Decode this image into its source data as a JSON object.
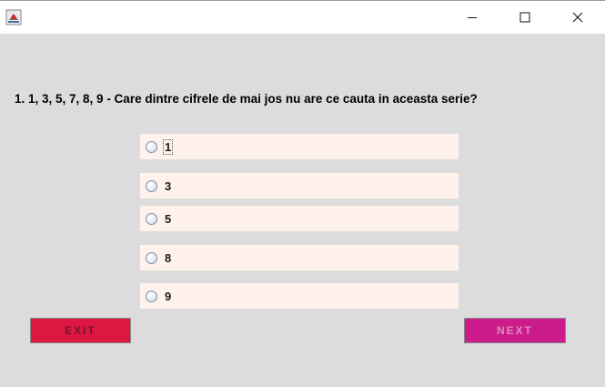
{
  "window": {
    "title_icon": "java-app-icon",
    "controls": {
      "minimize": "minimize-icon",
      "maximize": "maximize-icon",
      "close": "close-icon"
    }
  },
  "quiz": {
    "question": "1. 1, 3, 5, 7, 8, 9 - Care dintre cifrele de mai jos nu are ce cauta in aceasta serie?",
    "options": [
      "1",
      "3",
      "5",
      "8",
      "9"
    ],
    "selected": null,
    "focused_option": "1"
  },
  "buttons": {
    "exit_label": "EXIT",
    "next_label": "NEXT"
  },
  "colors": {
    "background": "#dcdcdc",
    "option_bg": "#fff2ec",
    "exit_bg": "#dc1742",
    "next_bg": "#cc1b8a"
  }
}
